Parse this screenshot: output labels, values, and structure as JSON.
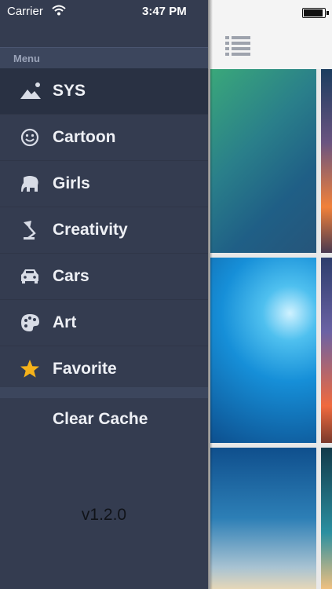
{
  "status_bar": {
    "carrier": "Carrier",
    "time": "3:47 PM"
  },
  "menu": {
    "header": "Menu",
    "items": [
      {
        "label": "SYS",
        "icon": "landscape-icon",
        "active": true
      },
      {
        "label": "Cartoon",
        "icon": "smiley-icon",
        "active": false
      },
      {
        "label": "Girls",
        "icon": "elephant-icon",
        "active": false
      },
      {
        "label": "Creativity",
        "icon": "lamp-icon",
        "active": false
      },
      {
        "label": "Cars",
        "icon": "car-icon",
        "active": false
      },
      {
        "label": "Art",
        "icon": "palette-icon",
        "active": false
      },
      {
        "label": "Favorite",
        "icon": "star-icon",
        "active": false
      }
    ],
    "clear_cache": "Clear Cache",
    "version": "v1.2.0"
  },
  "colors": {
    "drawer_bg": "#343c50",
    "active_bg": "#293143",
    "star": "#f5b21a"
  }
}
